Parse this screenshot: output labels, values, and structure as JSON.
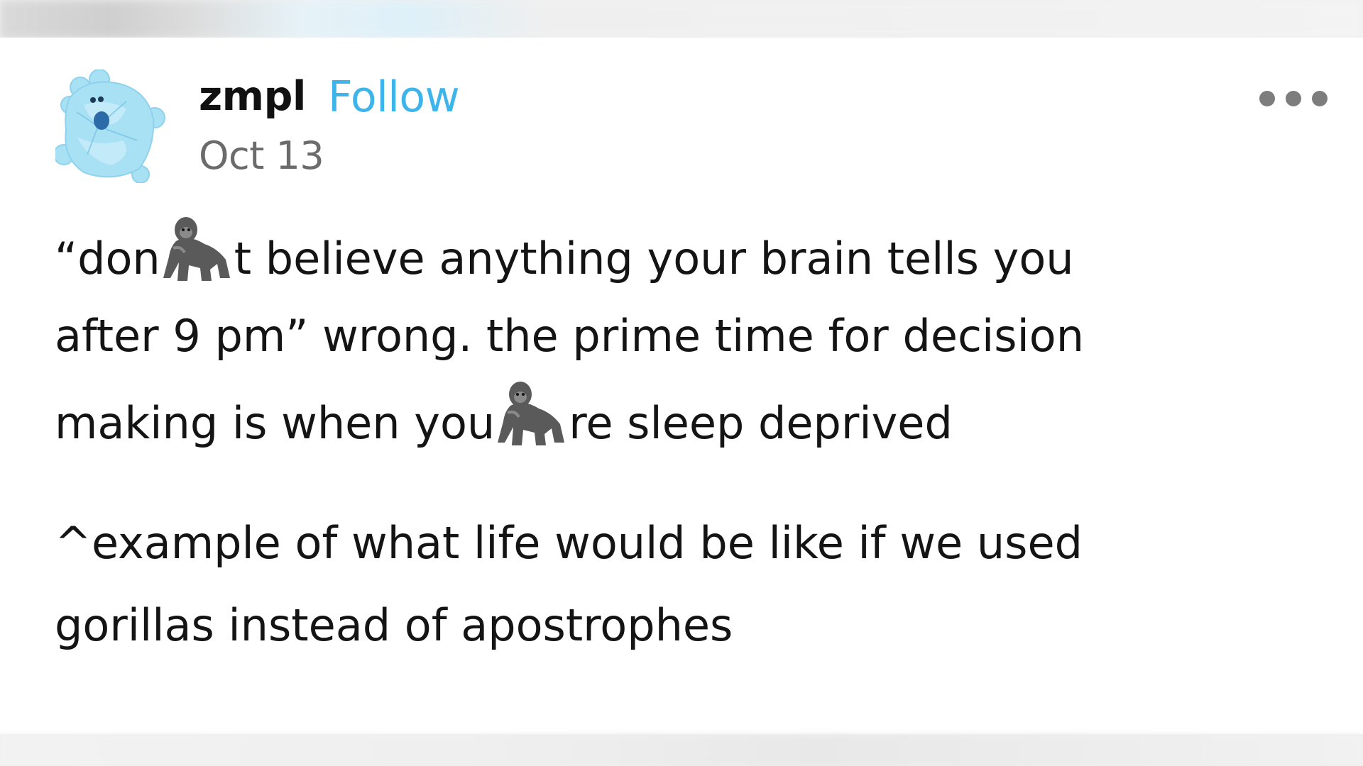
{
  "post": {
    "username": "zmpl",
    "follow_label": "Follow",
    "date": "Oct 13",
    "more_icon": "more-horizontal-icon",
    "avatar_icon": "blue-plush-avatar",
    "inline_emoji": "gorilla-emoji",
    "paragraph1": {
      "line1_a": "“don",
      "line1_b": "t believe anything your brain tells you",
      "line2": "after 9 pm” wrong. the prime time for decision",
      "line3_a": "making is when you",
      "line3_b": "re sleep deprived"
    },
    "paragraph2": {
      "line1": "^example of what life would be like if we used",
      "line2": "gorillas instead of apostrophes"
    }
  },
  "colors": {
    "follow": "#3db4ea",
    "username": "#111111",
    "date": "#6b6b6b",
    "body_text": "#141414",
    "avatar": "#9fdcf2"
  }
}
